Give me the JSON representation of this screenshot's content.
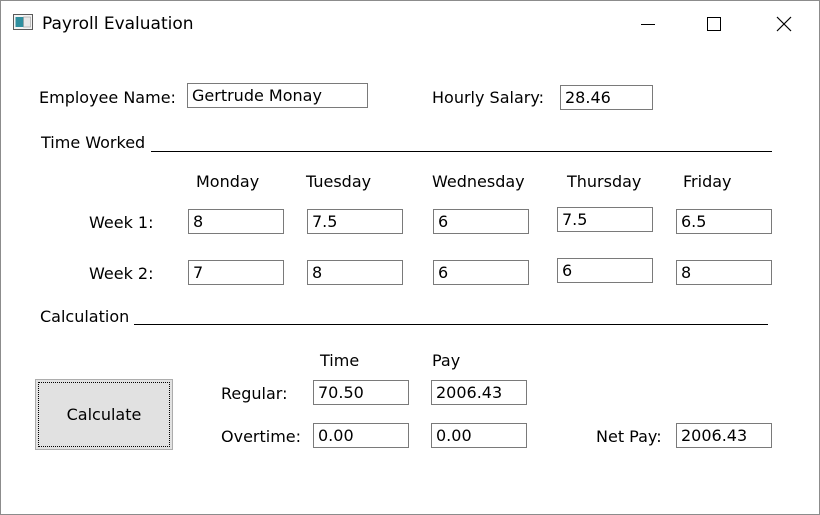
{
  "window": {
    "title": "Payroll Evaluation"
  },
  "employee": {
    "name_label": "Employee Name:",
    "name_value": "Gertrude Monay",
    "salary_label": "Hourly Salary:",
    "salary_value": "28.46"
  },
  "time_worked": {
    "section_label": "Time Worked",
    "days": [
      "Monday",
      "Tuesday",
      "Wednesday",
      "Thursday",
      "Friday"
    ],
    "weeks": [
      {
        "label": "Week 1:",
        "hours": [
          "8",
          "7.5",
          "6",
          "7.5",
          "6.5"
        ]
      },
      {
        "label": "Week 2:",
        "hours": [
          "7",
          "8",
          "6",
          "6",
          "8"
        ]
      }
    ]
  },
  "calculation": {
    "section_label": "Calculation",
    "button_label": "Calculate",
    "time_header": "Time",
    "pay_header": "Pay",
    "regular_label": "Regular:",
    "regular_time": "70.50",
    "regular_pay": "2006.43",
    "overtime_label": "Overtime:",
    "overtime_time": "0.00",
    "overtime_pay": "0.00",
    "net_pay_label": "Net Pay:",
    "net_pay_value": "2006.43"
  }
}
